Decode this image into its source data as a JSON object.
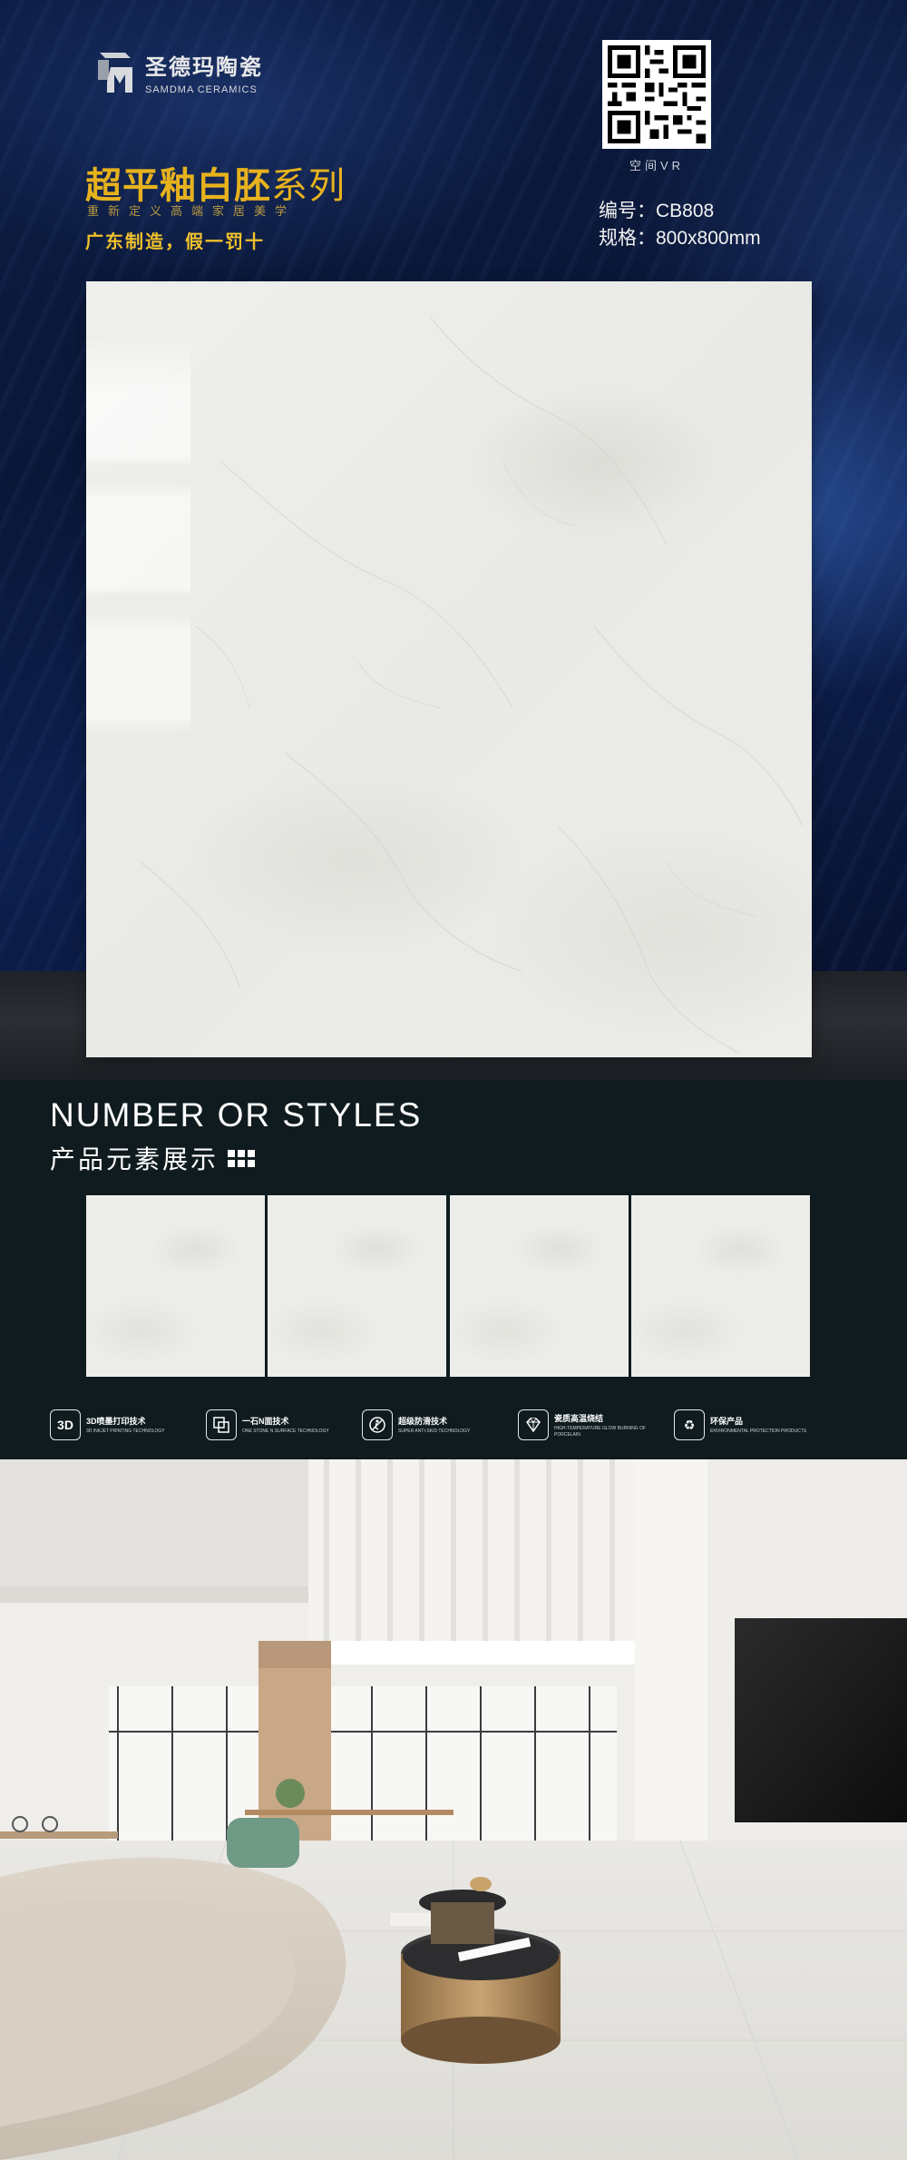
{
  "brand": {
    "name_cn": "圣德玛陶瓷",
    "name_en": "SAMDMA CERAMICS"
  },
  "series": {
    "title_main": "超平釉白胚",
    "title_suffix": "系列",
    "slogan": "重新定义高端家居美学",
    "made": "广东制造，假一罚十"
  },
  "qr": {
    "label": "空间VR"
  },
  "product": {
    "code": "编号：CB808",
    "size": "规格：800x800mm"
  },
  "styles": {
    "title": "NUMBER OR STYLES",
    "subtitle": "产品元素展示"
  },
  "features": [
    {
      "icon": "3d-print-icon",
      "glyph": "3D",
      "cn": "3D喷墨打印技术",
      "en": "3D INKJET PRINTING TECHNOLOGY"
    },
    {
      "icon": "stone-surface-icon",
      "glyph": "",
      "cn": "一石N面技术",
      "en": "ONE STONE N SURFACE TECHNOLOGY"
    },
    {
      "icon": "anti-slip-icon",
      "glyph": "",
      "cn": "超级防滑技术",
      "en": "SUPER ANTI-SKID TECHNOLOGY"
    },
    {
      "icon": "diamond-icon",
      "glyph": "",
      "cn": "瓷质高温烧结",
      "en": "HIGH-TEMPERATURE GLOW BURNING OF PORCELAIN"
    },
    {
      "icon": "recycle-icon",
      "glyph": "♻",
      "cn": "环保产品",
      "en": "ENVIRONMENTAL PROTECTION PRODUCTS"
    }
  ],
  "colors": {
    "accent_gold": "#e7b21d",
    "hero_blue": "#0d1d45",
    "section_dark": "#0f1b1e",
    "tile": "#ecece8"
  }
}
